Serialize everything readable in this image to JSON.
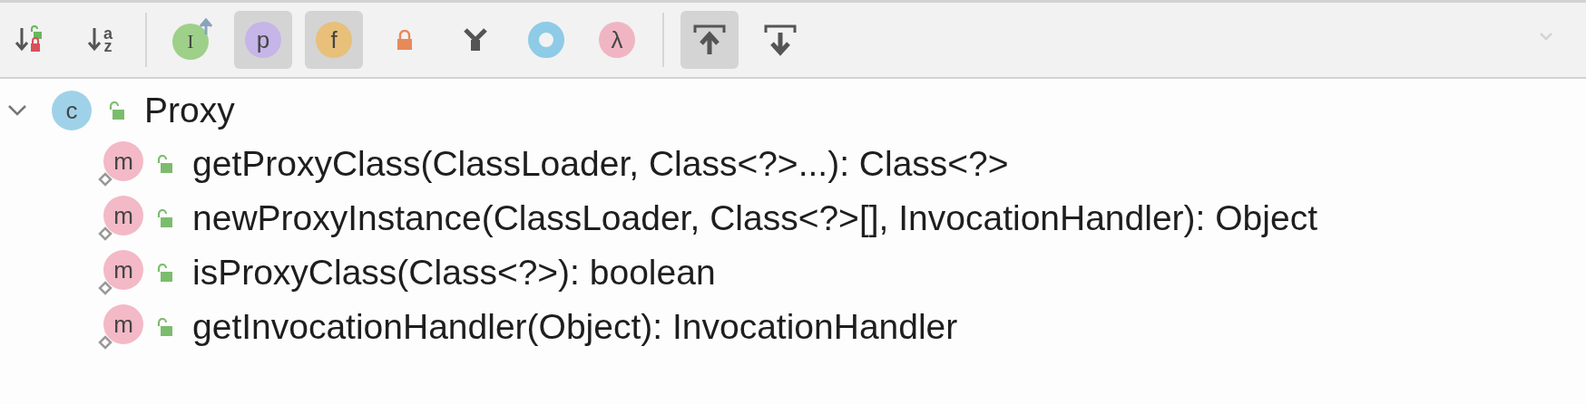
{
  "toolbar": {
    "buttons": [
      {
        "kind": "sort-visibility",
        "selected": false
      },
      {
        "kind": "sort-alpha",
        "glyphs": [
          "a",
          "z"
        ],
        "selected": false
      },
      {
        "kind": "separator"
      },
      {
        "kind": "inherited",
        "glyph": "I",
        "selected": false
      },
      {
        "kind": "badge",
        "glyph": "p",
        "color": "#c5b5e8",
        "selected": true
      },
      {
        "kind": "badge",
        "glyph": "f",
        "color": "#e8c07a",
        "selected": true
      },
      {
        "kind": "lock",
        "selected": false
      },
      {
        "kind": "fork",
        "selected": false
      },
      {
        "kind": "ring",
        "selected": false
      },
      {
        "kind": "badge",
        "glyph": "λ",
        "color": "#f0b5c3",
        "selected": false
      },
      {
        "kind": "separator"
      },
      {
        "kind": "scroll-to",
        "selected": true
      },
      {
        "kind": "scroll-from",
        "selected": false
      }
    ]
  },
  "tree": [
    {
      "kind": "class",
      "glyph": "c",
      "label": "Proxy",
      "expanded": true,
      "children": [
        {
          "kind": "method",
          "glyph": "m",
          "label": "getProxyClass(ClassLoader, Class<?>...): Class<?>"
        },
        {
          "kind": "method",
          "glyph": "m",
          "label": "newProxyInstance(ClassLoader, Class<?>[], InvocationHandler): Object"
        },
        {
          "kind": "method",
          "glyph": "m",
          "label": "isProxyClass(Class<?>): boolean"
        },
        {
          "kind": "method",
          "glyph": "m",
          "label": "getInvocationHandler(Object): InvocationHandler"
        }
      ]
    }
  ]
}
